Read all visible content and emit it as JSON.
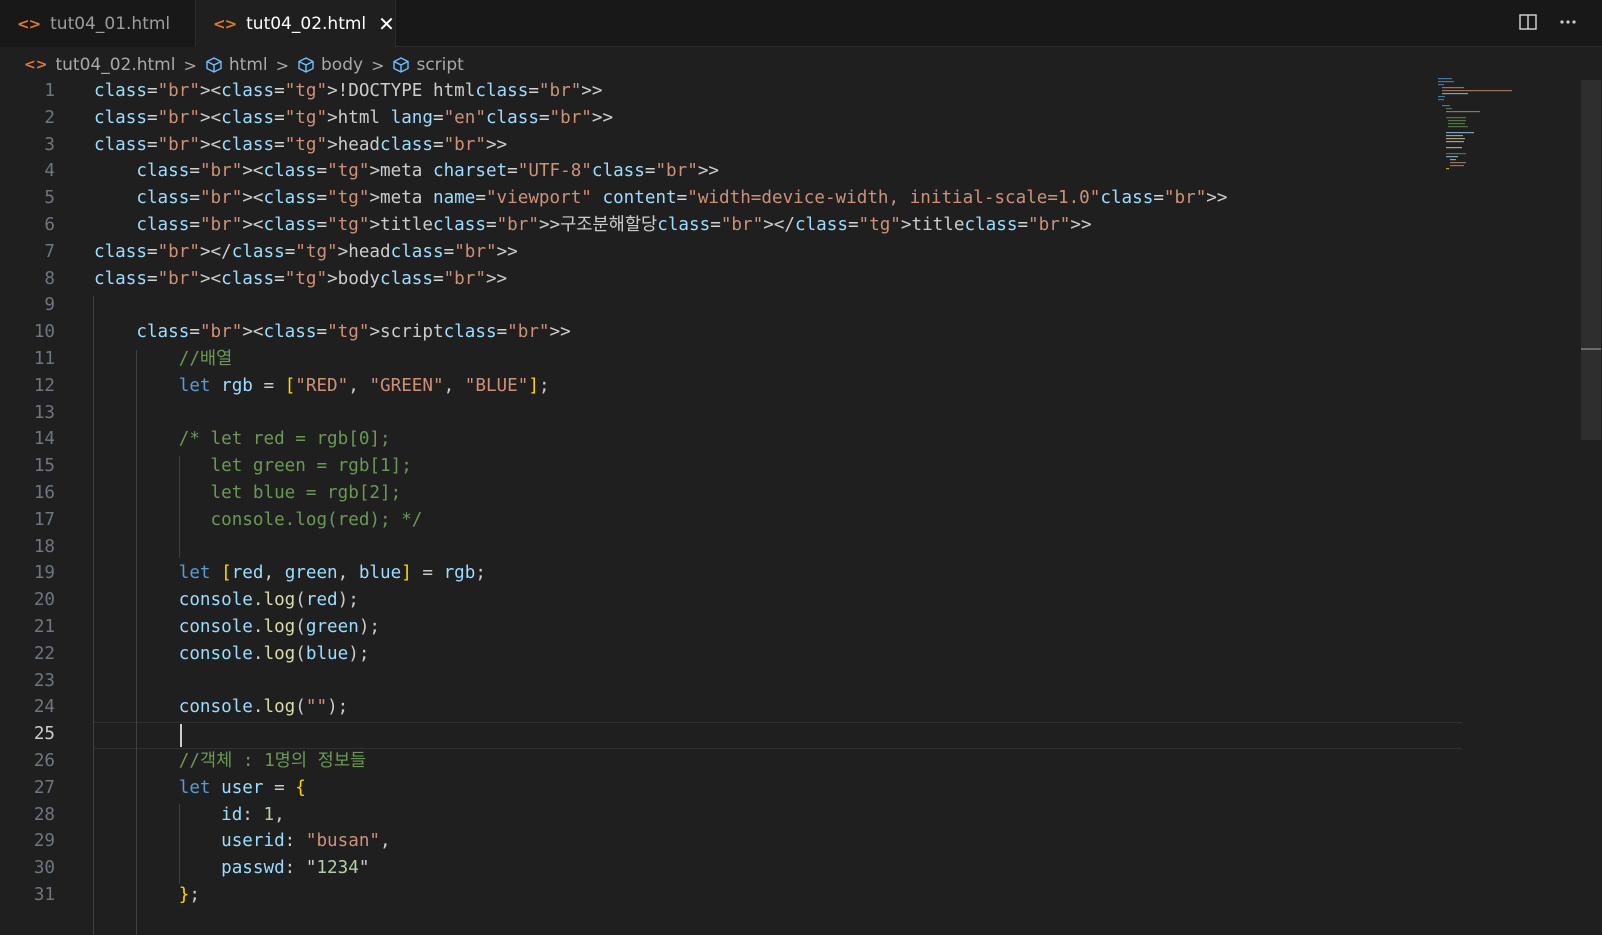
{
  "tabs": [
    {
      "label": "tut04_01.html",
      "active": false
    },
    {
      "label": "tut04_02.html",
      "active": true
    }
  ],
  "breadcrumb": {
    "file": "tut04_02.html",
    "items": [
      "html",
      "body",
      "script"
    ]
  },
  "editor": {
    "current_line": 25,
    "lines": [
      "<!DOCTYPE html>",
      "<html lang=\"en\">",
      "<head>",
      "    <meta charset=\"UTF-8\">",
      "    <meta name=\"viewport\" content=\"width=device-width, initial-scale=1.0\">",
      "    <title>구조분해할당</title>",
      "</head>",
      "<body>",
      "",
      "    <script>",
      "        //배열",
      "        let rgb = [\"RED\", \"GREEN\", \"BLUE\"];",
      "",
      "        /* let red = rgb[0];",
      "           let green = rgb[1];",
      "           let blue = rgb[2];",
      "           console.log(red); */",
      "",
      "        let [red, green, blue] = rgb;",
      "        console.log(red);",
      "        console.log(green);",
      "        console.log(blue);",
      "",
      "        console.log(\"\");",
      "",
      "        //객체 : 1명의 정보들",
      "        let user = {",
      "            id: 1,",
      "            userid: \"busan\",",
      "            passwd: \"1234\"",
      "        };"
    ]
  },
  "colors": {
    "keyword": "#569cd6",
    "string": "#ce9178",
    "comment": "#6a9955",
    "variable": "#9cdcfe",
    "function": "#dcdcaa",
    "number": "#b5cea8",
    "background": "#1f1f1f",
    "file_icon": "#e37933"
  },
  "icons": {
    "split_editor": "split-editor-icon",
    "more": "more-actions-icon"
  }
}
